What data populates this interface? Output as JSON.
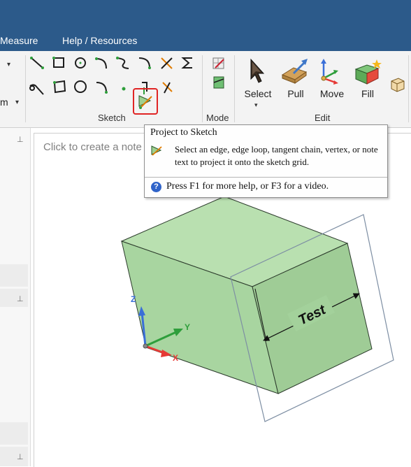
{
  "menubar": {
    "measure": "Measure",
    "help": "Help / Resources"
  },
  "ribbon": {
    "left_dropdown_label": "m",
    "groups": {
      "sketch": "Sketch",
      "mode": "Mode",
      "edit": "Edit"
    },
    "buttons": {
      "select": "Select",
      "pull": "Pull",
      "move": "Move",
      "fill": "Fill"
    }
  },
  "canvas": {
    "hint": "Click to create a note"
  },
  "tooltip": {
    "title": "Project to Sketch",
    "description": "Select an edge, edge loop, tangent chain, vertex, or note text to project it onto the sketch grid.",
    "help": "Press F1 for more help, or F3 for a video.",
    "help_icon": "?"
  },
  "model": {
    "dimension_text": "Test",
    "axes": {
      "x": "X",
      "y": "Y",
      "z": "Z"
    }
  },
  "colors": {
    "title_bar": "#2c5a8a",
    "box_face": "#a8d5a0",
    "box_edge": "#2b3a2b",
    "highlight": "#e02424",
    "axis_x": "#e53935",
    "axis_y": "#2e9e3b",
    "axis_z": "#3a6fd8"
  }
}
